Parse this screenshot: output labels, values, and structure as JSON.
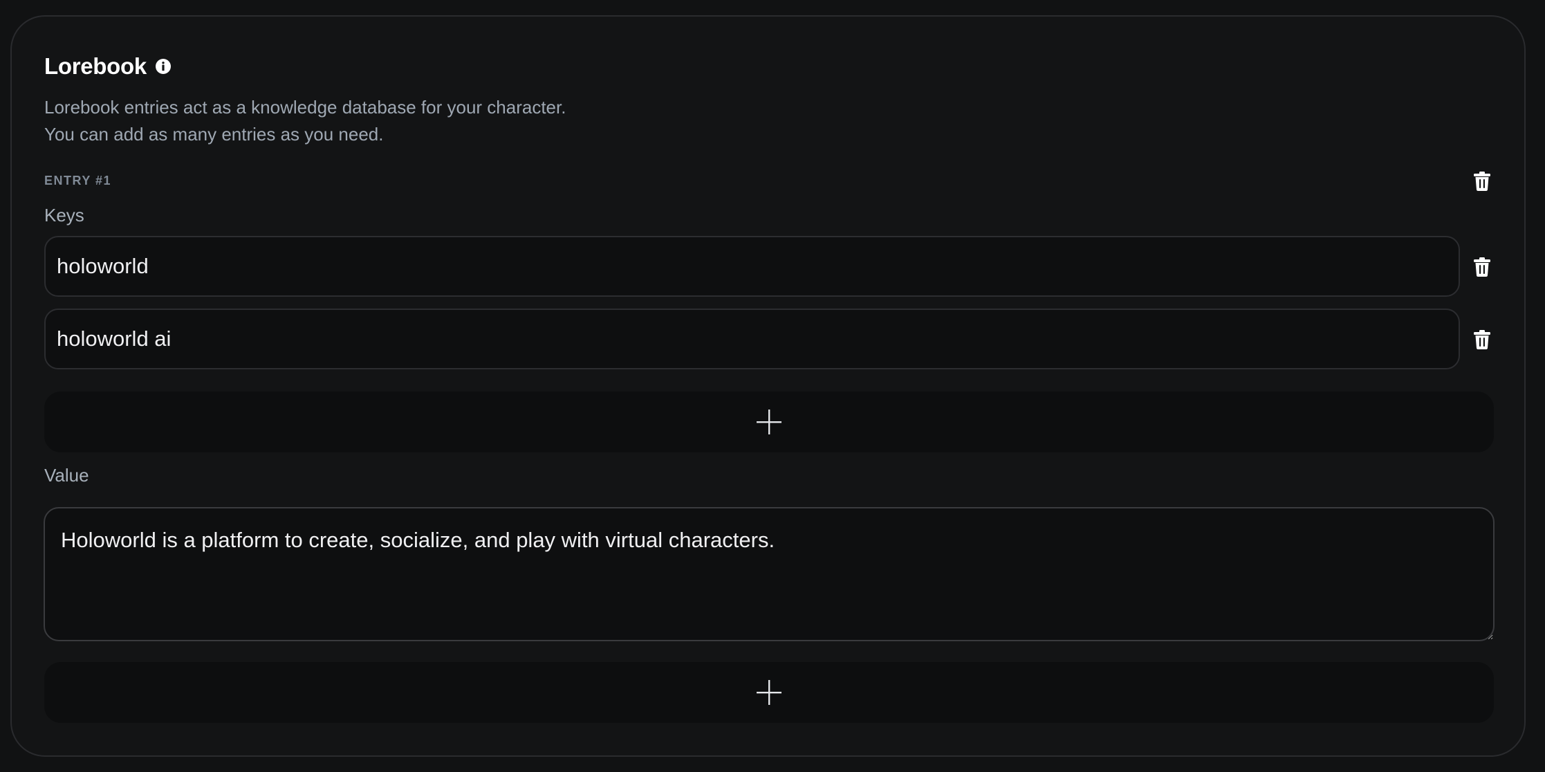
{
  "lorebook": {
    "title": "Lorebook",
    "description_line1": "Lorebook entries act as a knowledge database for your character.",
    "description_line2": "You can add as many entries as you need."
  },
  "entry": {
    "label": "ENTRY #1",
    "keys_label": "Keys",
    "keys": [
      "holoworld",
      "holoworld ai"
    ],
    "value_label": "Value",
    "value": "Holoworld is a platform to create, socialize, and play with virtual characters."
  },
  "icons": {
    "info": "info-icon",
    "trash": "trash-icon",
    "plus": "plus-icon"
  },
  "colors": {
    "background": "#111213",
    "card": "#131415",
    "input_bg": "#0e0f10",
    "muted_text": "#9fa8b3"
  }
}
